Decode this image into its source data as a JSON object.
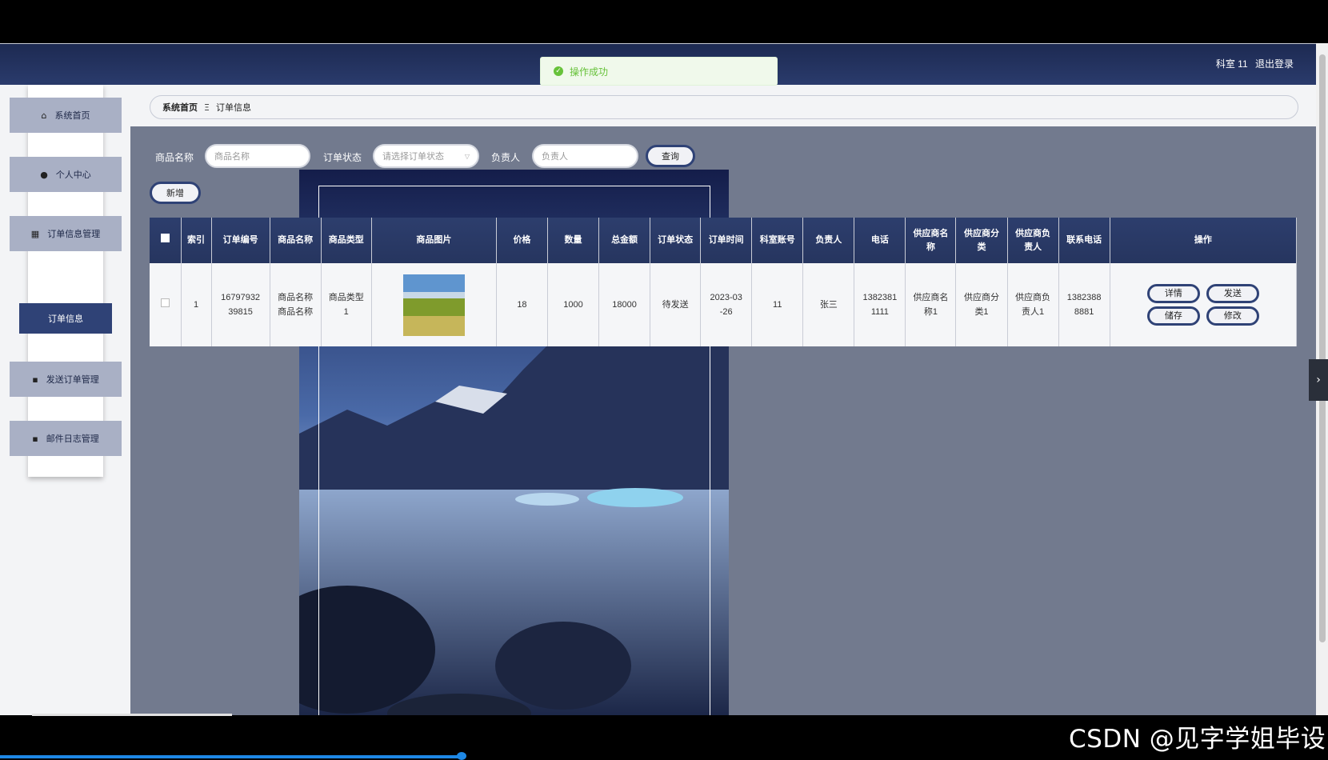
{
  "header": {
    "user_name": "科室 11",
    "logout": "退出登录"
  },
  "toast": {
    "message": "操作成功",
    "color": "#67c23a"
  },
  "sidebar": {
    "items": [
      {
        "label": "系统首页",
        "icon": "home-icon"
      },
      {
        "label": "个人中心",
        "icon": "user-icon"
      },
      {
        "label": "订单信息管理",
        "icon": "grid-icon"
      },
      {
        "label": "发送订单管理",
        "icon": "folder-icon"
      },
      {
        "label": "邮件日志管理",
        "icon": "folder-icon"
      }
    ],
    "sub_item": "订单信息"
  },
  "breadcrumb": {
    "home": "系统首页",
    "separator": "Ξ",
    "current": "订单信息"
  },
  "search": {
    "product_label": "商品名称",
    "product_placeholder": "商品名称",
    "status_label": "订单状态",
    "status_placeholder": "请选择订单状态",
    "owner_label": "负责人",
    "owner_placeholder": "负责人",
    "query_button": "查询"
  },
  "add_button": "新增",
  "table": {
    "headers": [
      "索引",
      "订单编号",
      "商品名称",
      "商品类型",
      "商品图片",
      "价格",
      "数量",
      "总金额",
      "订单状态",
      "订单时间",
      "科室账号",
      "负责人",
      "电话",
      "供应商名称",
      "供应商分类",
      "供应商负责人",
      "联系电话",
      "操作"
    ],
    "rows": [
      {
        "index": "1",
        "order_no": "1679793239815",
        "product_name": "商品名称商品名称",
        "product_type": "商品类型1",
        "price": "18",
        "quantity": "1000",
        "total": "18000",
        "status": "待发送",
        "order_time": "2023-03-26",
        "dept_account": "11",
        "owner": "张三",
        "phone": "13823811111",
        "supplier_name": "供应商名称1",
        "supplier_category": "供应商分类1",
        "supplier_owner": "供应商负责人1",
        "contact_phone": "13823888881"
      }
    ],
    "actions": [
      "详情",
      "发送",
      "储存",
      "修改"
    ]
  },
  "watermark": "CSDN @见字学姐毕设",
  "colors": {
    "navy": "#2f4276",
    "header": "#26355f",
    "content_bg": "#727a8e"
  }
}
